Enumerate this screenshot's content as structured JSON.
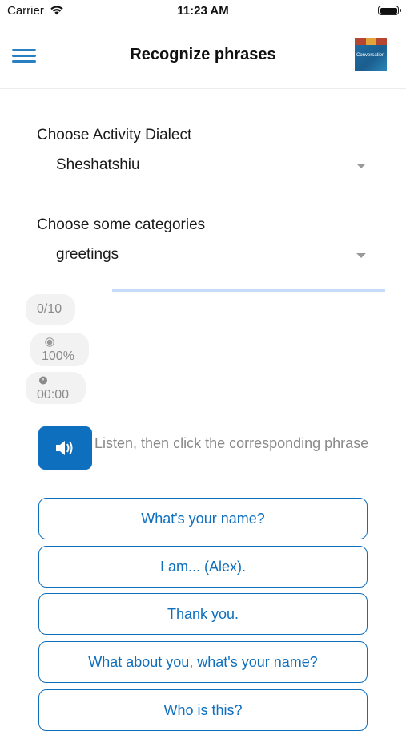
{
  "status_bar": {
    "carrier": "Carrier",
    "time": "11:23 AM"
  },
  "header": {
    "title": "Recognize phrases",
    "logo_text": "Conversation"
  },
  "dialect": {
    "label": "Choose Activity Dialect",
    "value": "Sheshatshiu"
  },
  "categories": {
    "label": "Choose some categories",
    "value": "greetings"
  },
  "stats": {
    "score": "0/10",
    "accuracy": "100%",
    "timer": "00:00"
  },
  "instruction": "Listen, then click the corresponding phrase",
  "options": [
    "What's your name?",
    "I am... (Alex).",
    "Thank you.",
    "What about you, what's your name?",
    "Who is this?"
  ],
  "colors": {
    "accent": "#0e6fbe",
    "menu": "#2a7fc1",
    "muted": "#8a8a8a",
    "chip_bg": "#f2f2f2",
    "progress": "#c6dbf7"
  },
  "icons": [
    "wifi-icon",
    "battery-icon",
    "menu-icon",
    "speaker-icon",
    "target-icon",
    "timer-icon",
    "chevron-down-icon"
  ]
}
